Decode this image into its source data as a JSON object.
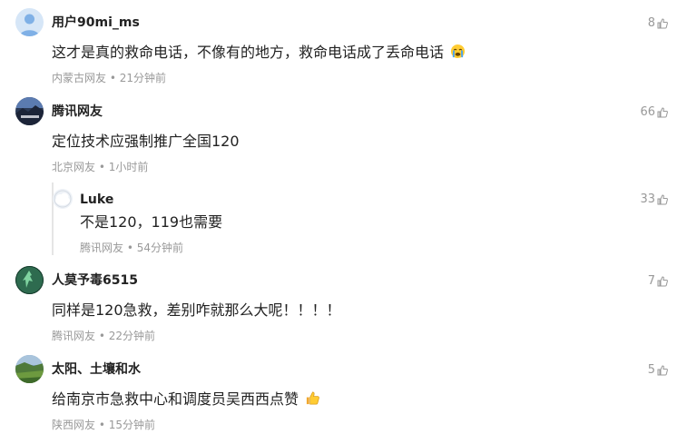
{
  "comments": [
    {
      "user": "用户90mi_ms",
      "text": "这才是真的救命电话，不像有的地方，救命电话成了丢命电话",
      "emoji": "crying-face-icon",
      "location": "内蒙古网友",
      "time": "21分钟前",
      "meta": "内蒙古网友 • 21分钟前",
      "likes": "8",
      "avatar": "default-user-avatar"
    },
    {
      "user": "腾讯网友",
      "text": "定位技术应强制推广全国120",
      "location": "北京网友",
      "time": "1小时前",
      "meta": "北京网友 • 1小时前",
      "likes": "66",
      "avatar": "night-landscape-avatar"
    },
    {
      "user": "Luke",
      "text": "不是120，119也需要",
      "location": "腾讯网友",
      "time": "54分钟前",
      "meta": "腾讯网友 • 54分钟前",
      "likes": "33",
      "avatar": "cloud-avatar",
      "is_reply": true
    },
    {
      "user": "人莫予毒6515",
      "text": "同样是120急救，差别咋就那么大呢！！！！",
      "location": "腾讯网友",
      "time": "22分钟前",
      "meta": "腾讯网友 • 22分钟前",
      "likes": "7",
      "avatar": "green-figure-avatar"
    },
    {
      "user": "太阳、土壤和水",
      "text": "给南京市急救中心和调度员吴西西点赞",
      "emoji": "thumbs-up-icon",
      "location": "陕西网友",
      "time": "15分钟前",
      "meta": "陕西网友 • 15分钟前",
      "likes": "5",
      "avatar": "field-landscape-avatar"
    }
  ],
  "colors": {
    "name": "#222222",
    "text": "#222222",
    "meta": "#999999",
    "likes": "#999999"
  }
}
